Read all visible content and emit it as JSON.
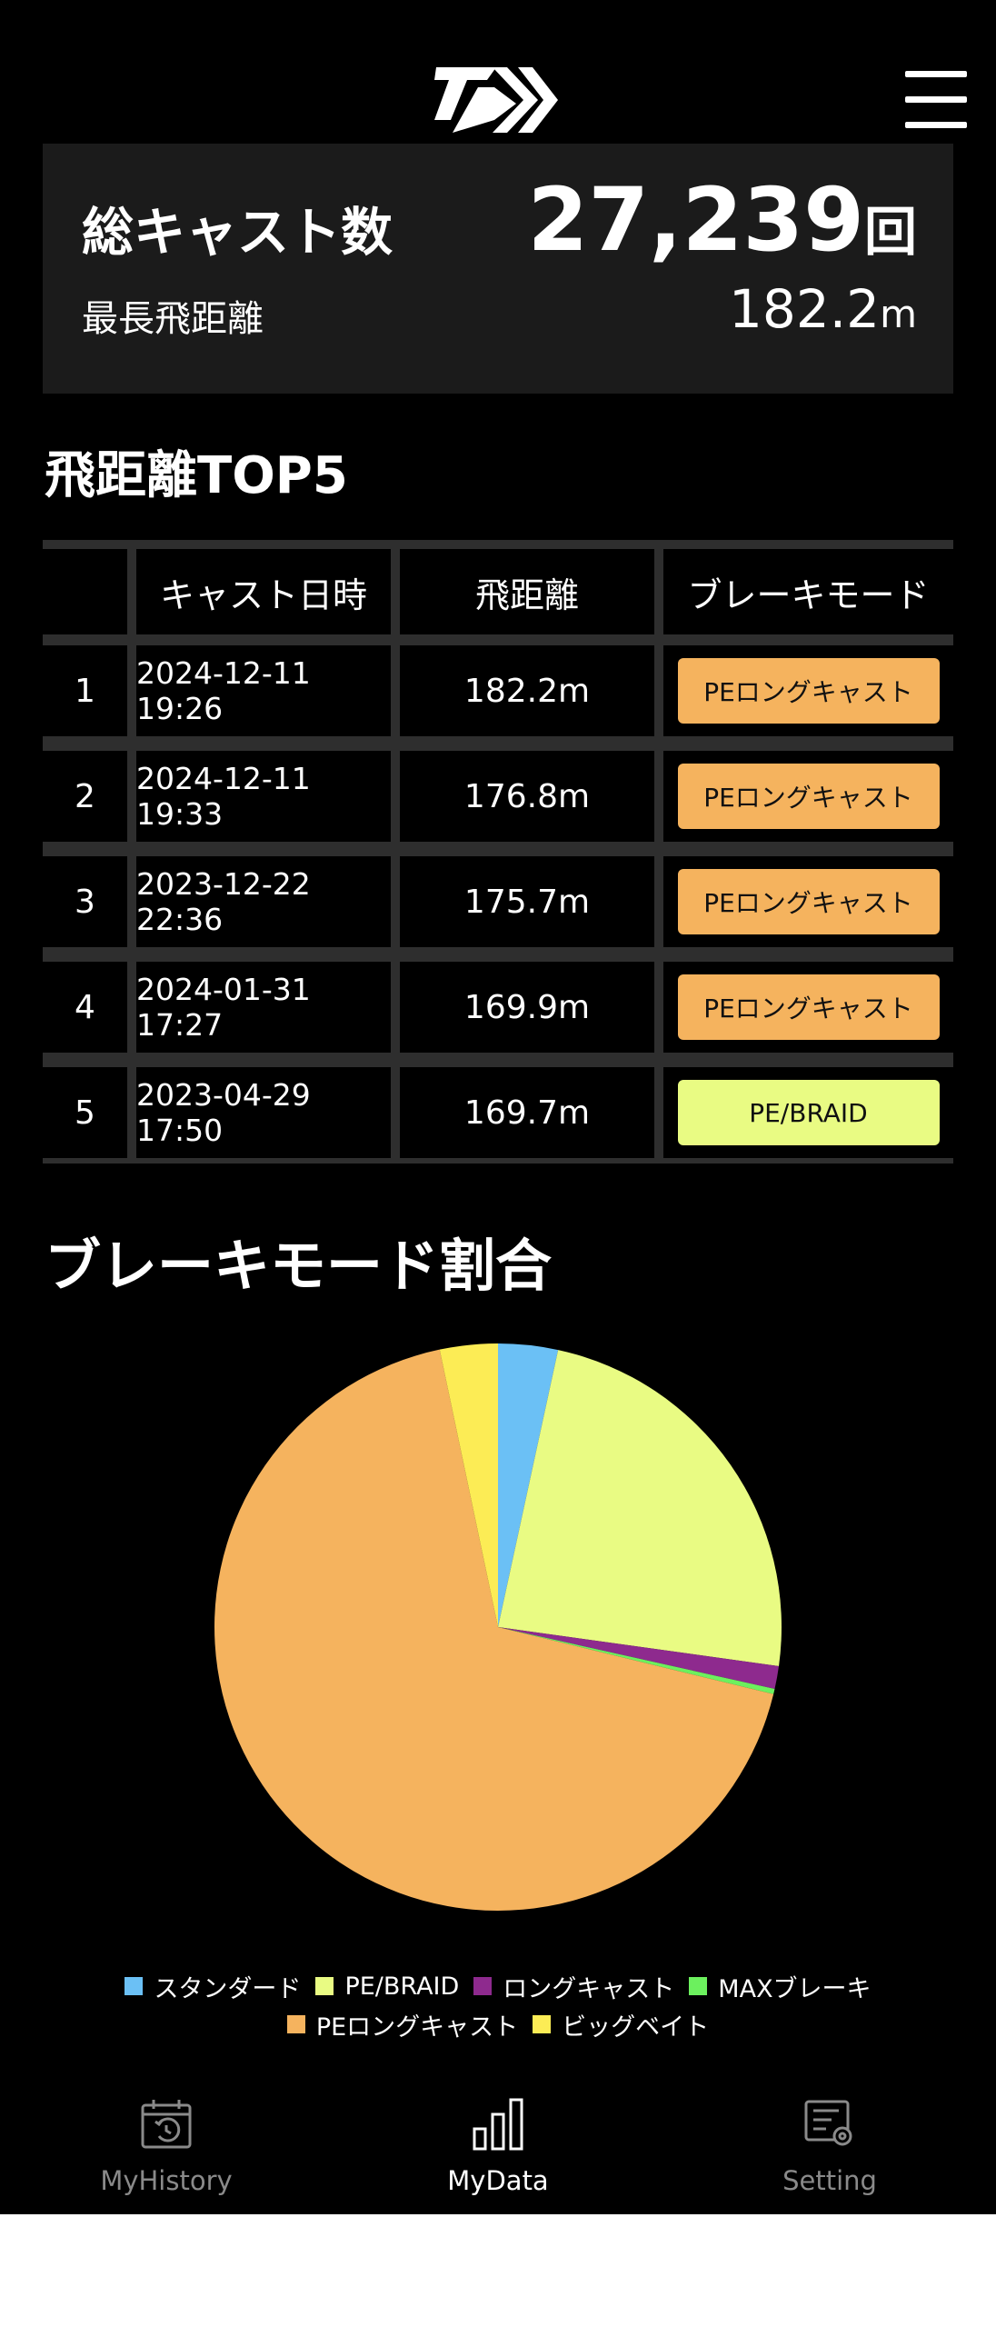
{
  "header": {
    "logo_icon": "daiwa-logo-icon",
    "menu_icon": "hamburger-menu-icon"
  },
  "summary": {
    "total_casts_label": "総キャスト数",
    "total_casts_value": "27,239",
    "total_casts_unit": "回",
    "longest_label": "最長飛距離",
    "longest_value": "182.2",
    "longest_unit": "m"
  },
  "top5": {
    "title": "飛距離TOP5",
    "columns": [
      "",
      "キャスト日時",
      "飛距離",
      "ブレーキモード"
    ],
    "rows": [
      {
        "rank": "1",
        "datetime": "2024-12-11 19:26",
        "distance": "182.2m",
        "mode": "PEロングキャスト",
        "mode_color": "#F5B35E"
      },
      {
        "rank": "2",
        "datetime": "2024-12-11 19:33",
        "distance": "176.8m",
        "mode": "PEロングキャスト",
        "mode_color": "#F5B35E"
      },
      {
        "rank": "3",
        "datetime": "2023-12-22 22:36",
        "distance": "175.7m",
        "mode": "PEロングキャスト",
        "mode_color": "#F5B35E"
      },
      {
        "rank": "4",
        "datetime": "2024-01-31 17:27",
        "distance": "169.9m",
        "mode": "PEロングキャスト",
        "mode_color": "#F5B35E"
      },
      {
        "rank": "5",
        "datetime": "2023-04-29 17:50",
        "distance": "169.7m",
        "mode": "PE/BRAID",
        "mode_color": "#E9FB83"
      }
    ]
  },
  "brake_ratio": {
    "title": "ブレーキモード割合",
    "legend_rows": [
      [
        "スタンダード",
        "PE/BRAID",
        "ロングキャスト",
        "MAXブレーキ"
      ],
      [
        "PEロングキャスト",
        "ビッグベイト"
      ]
    ]
  },
  "chart_data": {
    "type": "pie",
    "title": "ブレーキモード割合",
    "labels": [
      "スタンダード",
      "PE/BRAID",
      "ロングキャスト",
      "MAXブレーキ",
      "PEロングキャスト",
      "ビッグベイト"
    ],
    "values": [
      3.4,
      23.8,
      1.3,
      0.3,
      67.9,
      3.3
    ],
    "colors": [
      "#6BC0F5",
      "#E9FB83",
      "#8E2A8E",
      "#6CF05E",
      "#F5B35E",
      "#FCEC55"
    ],
    "legend_position": "bottom"
  },
  "bottom_nav": [
    {
      "label": "MyHistory",
      "icon": "calendar-history-icon",
      "active": false
    },
    {
      "label": "MyData",
      "icon": "bar-chart-icon",
      "active": true
    },
    {
      "label": "Setting",
      "icon": "settings-gear-icon",
      "active": false
    }
  ],
  "colors": {
    "background": "#000000",
    "panel": "#1B1B1B",
    "grid": "#2E2E2E",
    "nav_inactive": "#8A8A8A",
    "nav_active": "#FFFFFF"
  }
}
